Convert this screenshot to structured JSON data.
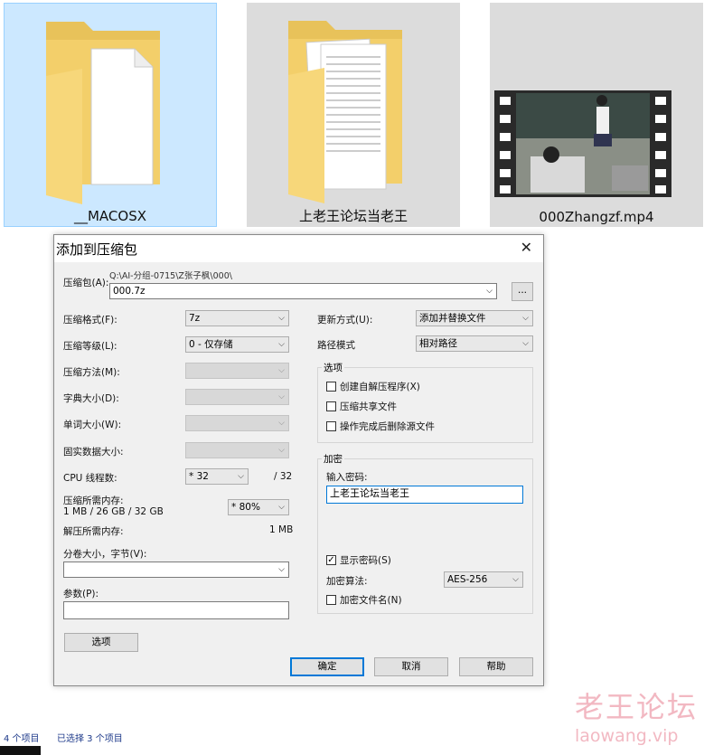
{
  "files": [
    {
      "name": "__MACOSX",
      "type": "folder-icon"
    },
    {
      "name": "上老王论坛当老王",
      "type": "folder-icon"
    },
    {
      "name": "000Zhangzf.mp4",
      "type": "video-thumbnail"
    }
  ],
  "dialog": {
    "title": "添加到压缩包",
    "close": "✕",
    "archive_label": "压缩包(A):",
    "archive_path": "Q:\\AI-分组-0715\\Z张子枫\\000\\",
    "archive_name": "000.7z",
    "browse_label": "...",
    "format_label": "压缩格式(F):",
    "format_value": "7z",
    "level_label": "压缩等级(L):",
    "level_value": "0 - 仅存储",
    "method_label": "压缩方法(M):",
    "dict_label": "字典大小(D):",
    "word_label": "单词大小(W):",
    "solid_label": "固实数据大小:",
    "threads_label": "CPU 线程数:",
    "threads_value": "* 32",
    "threads_max": "/ 32",
    "mem_label": "压缩所需内存:",
    "mem_detail": "1 MB / 26 GB / 32 GB",
    "mem_value": "* 80%",
    "decomp_label": "解压所需内存:",
    "decomp_value": "1 MB",
    "split_label": "分卷大小，字节(V):",
    "params_label": "参数(P):",
    "options_button": "选项",
    "update_label": "更新方式(U):",
    "update_value": "添加并替换文件",
    "path_label": "路径模式",
    "path_value": "相对路径",
    "options_group": "选项",
    "opt_sfx": "创建自解压程序(X)",
    "opt_shared": "压缩共享文件",
    "opt_delete": "操作完成后删除源文件",
    "encrypt_group": "加密",
    "password_label": "输入密码:",
    "password_value": "上老王论坛当老王",
    "show_password": "显示密码(S)",
    "enc_method_label": "加密算法:",
    "enc_method_value": "AES-256",
    "encrypt_names": "加密文件名(N)",
    "ok": "确定",
    "cancel": "取消",
    "help": "帮助"
  },
  "status": {
    "items": "4 个项目",
    "selected": "已选择 3 个项目"
  },
  "watermark": {
    "name": "老王论坛",
    "url": "laowang.vip"
  }
}
